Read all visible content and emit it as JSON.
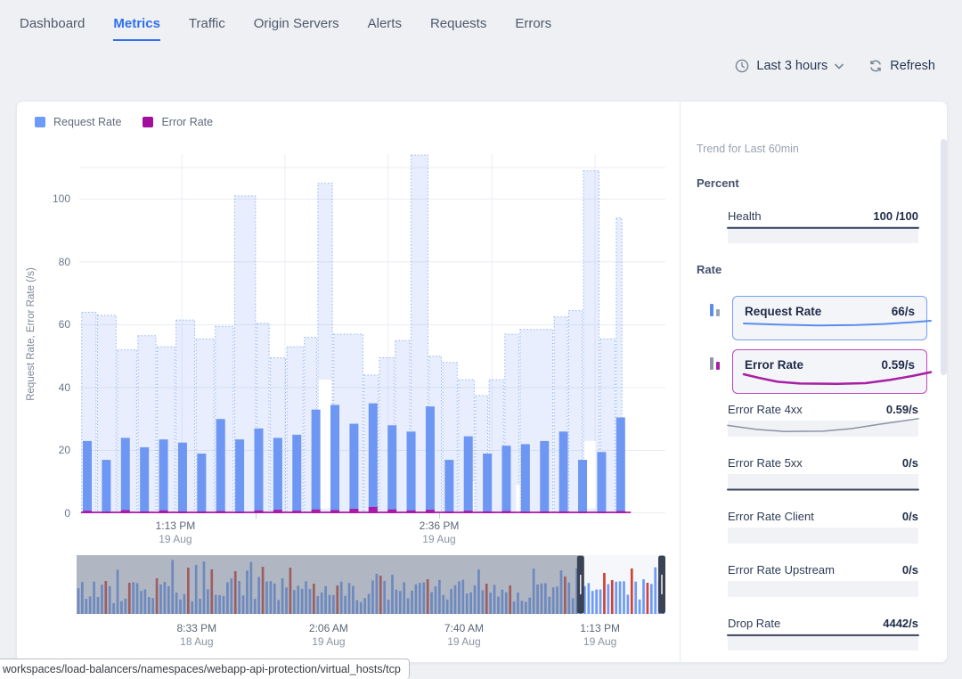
{
  "nav": {
    "tabs": [
      {
        "label": "Dashboard",
        "active": false
      },
      {
        "label": "Metrics",
        "active": true
      },
      {
        "label": "Traffic",
        "active": false
      },
      {
        "label": "Origin Servers",
        "active": false
      },
      {
        "label": "Alerts",
        "active": false
      },
      {
        "label": "Requests",
        "active": false
      },
      {
        "label": "Errors",
        "active": false
      }
    ],
    "active_color": "#2f6fed"
  },
  "toolbar": {
    "time_range_label": "Last 3 hours",
    "refresh_label": "Refresh"
  },
  "legend": [
    {
      "label": "Request Rate",
      "color": "#6d9bf5"
    },
    {
      "label": "Error Rate",
      "color": "#a2109b"
    }
  ],
  "chart_data": {
    "type": "bar",
    "title": "",
    "ylabel": "Request Rate, Error Rate (/s)",
    "yticks": [
      0,
      20,
      40,
      60,
      80,
      100
    ],
    "y_minor_gridlines": [
      110
    ],
    "ymax": 114.3,
    "grid": true,
    "x_axis_labels": [
      {
        "time": "1:13 PM",
        "date": "19 Aug",
        "frac": 0.164
      },
      {
        "time": "2:36 PM",
        "date": "19 Aug",
        "frac": 0.614
      }
    ],
    "x_tick_fracs": [
      0.301,
      0.614
    ],
    "v_gridline_fracs": [
      0.175,
      0.351,
      0.527,
      0.704,
      0.88
    ],
    "series": [
      {
        "name": "Request Rate",
        "type": "bar",
        "color": "#6e96f3",
        "start_frac": 0.0137,
        "step_frac": 0.0325,
        "bar_width_frac": 0.0152,
        "values": [
          23,
          17,
          24,
          21,
          23.5,
          22.5,
          19,
          30,
          23.5,
          27,
          24,
          25,
          33,
          34.5,
          28.5,
          35,
          28,
          26,
          34,
          17,
          24.5,
          19,
          21.5,
          22,
          23,
          26,
          17,
          19.5,
          30.5
        ]
      },
      {
        "name": "Error Rate",
        "type": "bar",
        "color": "#ac1ba5",
        "values": [
          0.8,
          0.5,
          1,
          0.6,
          0.9,
          0.6,
          0.6,
          0.7,
          0.5,
          0.9,
          1.1,
          0.8,
          1.2,
          1,
          1.4,
          2,
          1.2,
          0.9,
          1.1,
          0.6,
          0.8,
          0.6,
          0.7,
          0.5,
          0.6,
          0.6,
          0.5,
          0.5,
          0.7
        ],
        "baseline_end_frac": 0.941
      },
      {
        "name": "Request Rate (bucket range)",
        "type": "step-area",
        "fill": "rgba(110,150,243,0.16)",
        "stroke": "rgba(123,164,240,0.8)",
        "segments": [
          [
            0.003,
            0.03,
            64
          ],
          [
            0.03,
            0.064,
            63
          ],
          [
            0.064,
            0.099,
            52
          ],
          [
            0.099,
            0.132,
            56.5
          ],
          [
            0.132,
            0.164,
            53
          ],
          [
            0.164,
            0.198,
            61.5
          ],
          [
            0.198,
            0.231,
            55.5
          ],
          [
            0.231,
            0.264,
            59.5
          ],
          [
            0.264,
            0.302,
            101
          ],
          [
            0.302,
            0.325,
            60.5
          ],
          [
            0.325,
            0.353,
            49.5
          ],
          [
            0.353,
            0.383,
            53
          ],
          [
            0.383,
            0.406,
            56
          ],
          [
            0.406,
            0.433,
            105
          ],
          [
            0.433,
            0.485,
            57
          ],
          [
            0.485,
            0.511,
            44
          ],
          [
            0.511,
            0.538,
            49.5
          ],
          [
            0.538,
            0.565,
            55
          ],
          [
            0.565,
            0.596,
            114
          ],
          [
            0.596,
            0.619,
            50
          ],
          [
            0.619,
            0.646,
            48
          ],
          [
            0.646,
            0.675,
            42.5
          ],
          [
            0.675,
            0.698,
            37.5
          ],
          [
            0.698,
            0.725,
            42.5
          ],
          [
            0.725,
            0.751,
            57
          ],
          [
            0.751,
            0.809,
            58.5
          ],
          [
            0.809,
            0.834,
            62.5
          ],
          [
            0.834,
            0.859,
            64.5
          ],
          [
            0.859,
            0.888,
            109
          ],
          [
            0.888,
            0.915,
            55.5
          ],
          [
            0.915,
            0.927,
            94
          ]
        ],
        "gaps": [
          [
            0.406,
            0.433,
            1.5,
            42.5
          ],
          [
            0.859,
            0.883,
            1.5,
            23
          ],
          [
            0.743,
            0.754,
            0,
            9
          ],
          [
            0.663,
            0.676,
            0,
            10
          ]
        ]
      }
    ]
  },
  "brush": {
    "bar_count": 150,
    "seed": 42,
    "bar_color": "#6d9bf5",
    "red_color": "#cf4437",
    "background": "#f5f7fb",
    "overlay_color": "rgba(110,120,138,0.5)",
    "handle_color": "#3a4254",
    "selection_start_frac": 0.856,
    "red_fracs": [
      0.045,
      0.09,
      0.135,
      0.19,
      0.225,
      0.27,
      0.315,
      0.36,
      0.4,
      0.445,
      0.52,
      0.6,
      0.7,
      0.74,
      0.835,
      0.9,
      0.915,
      0.945,
      0.97
    ],
    "axis_labels": [
      {
        "time": "8:33 PM",
        "date": "18 Aug",
        "frac": 0.204
      },
      {
        "time": "2:06 AM",
        "date": "19 Aug",
        "frac": 0.428
      },
      {
        "time": "7:40 AM",
        "date": "19 Aug",
        "frac": 0.658
      },
      {
        "time": "1:13 PM",
        "date": "19 Aug",
        "frac": 0.889
      }
    ]
  },
  "sidebar": {
    "trend_title": "Trend for Last 60min",
    "items": [
      {
        "kind": "header",
        "label": "Percent"
      },
      {
        "kind": "metric",
        "label": "Health",
        "value": "100 /100",
        "line_color": "#2e3b5e",
        "line_width": 2,
        "points": [
          [
            0,
            0.04
          ],
          [
            1,
            0.04
          ]
        ]
      },
      {
        "kind": "header",
        "label": "Rate"
      },
      {
        "kind": "card",
        "label": "Request Rate",
        "value": "66/s",
        "accent": "#74a0f5",
        "line_color": "#5b8def",
        "line_width": 2,
        "icon_bars": [
          {
            "color": "#5b8def",
            "h": 14
          },
          {
            "color": "#9aa3b4",
            "h": 8
          }
        ],
        "points": [
          [
            0,
            0.45
          ],
          [
            0.2,
            0.52
          ],
          [
            0.4,
            0.56
          ],
          [
            0.6,
            0.54
          ],
          [
            0.75,
            0.48
          ],
          [
            0.9,
            0.38
          ],
          [
            1,
            0.3
          ]
        ]
      },
      {
        "kind": "card",
        "label": "Error Rate",
        "value": "0.59/s",
        "accent": "#c145c1",
        "line_color": "#a81fa4",
        "line_width": 2.5,
        "icon_bars": [
          {
            "color": "#8e97a8",
            "h": 14
          },
          {
            "color": "#a81fa4",
            "h": 9
          }
        ],
        "points": [
          [
            0,
            0.3
          ],
          [
            0.08,
            0.5
          ],
          [
            0.18,
            0.72
          ],
          [
            0.3,
            0.82
          ],
          [
            0.5,
            0.84
          ],
          [
            0.65,
            0.8
          ],
          [
            0.78,
            0.62
          ],
          [
            0.9,
            0.4
          ],
          [
            1,
            0.18
          ]
        ]
      },
      {
        "kind": "metric",
        "label": "Error Rate 4xx",
        "value": "0.59/s",
        "line_color": "#8a93a5",
        "line_width": 1.5,
        "points": [
          [
            0,
            0.3
          ],
          [
            0.15,
            0.55
          ],
          [
            0.3,
            0.68
          ],
          [
            0.5,
            0.66
          ],
          [
            0.65,
            0.5
          ],
          [
            0.8,
            0.22
          ],
          [
            1,
            -0.12
          ]
        ]
      },
      {
        "kind": "metric",
        "label": "Error Rate 5xx",
        "value": "0/s",
        "line_color": "#39415e",
        "line_width": 2,
        "points": [
          [
            0,
            0.97
          ],
          [
            1,
            0.97
          ]
        ]
      },
      {
        "kind": "metric",
        "label": "Error Rate Client",
        "value": "0/s",
        "line_color": "",
        "line_width": 0,
        "points": []
      },
      {
        "kind": "metric",
        "label": "Error Rate Upstream",
        "value": "0/s",
        "line_color": "",
        "line_width": 0,
        "points": []
      },
      {
        "kind": "metric",
        "label": "Drop Rate",
        "value": "4442/s",
        "line_color": "#39415e",
        "line_width": 2,
        "points": [
          [
            0,
            0.05
          ],
          [
            1,
            0.05
          ]
        ]
      }
    ]
  },
  "statusbar": {
    "link_preview": "workspaces/load-balancers/namespaces/webapp-api-protection/virtual_hosts/tcp"
  }
}
